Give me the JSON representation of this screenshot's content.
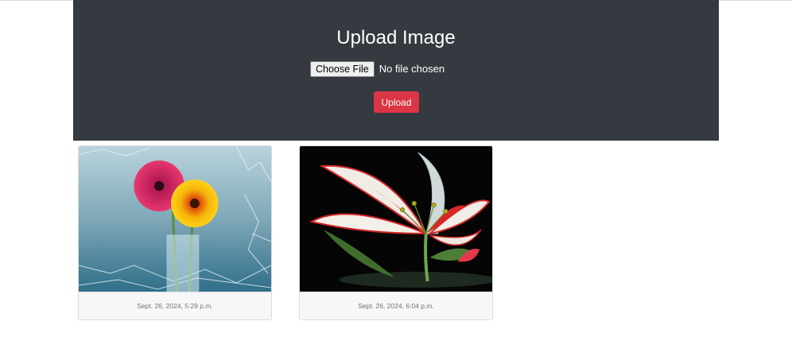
{
  "upload": {
    "title": "Upload Image",
    "choose_file_label": "Choose File",
    "file_status": "No file chosen",
    "upload_button": "Upload"
  },
  "gallery": {
    "items": [
      {
        "timestamp": "Sept. 26, 2024, 5:29 p.m."
      },
      {
        "timestamp": "Sept. 26, 2024, 6:04 p.m."
      }
    ]
  },
  "colors": {
    "panel_bg": "#343a40",
    "upload_button_bg": "#dc3545"
  }
}
